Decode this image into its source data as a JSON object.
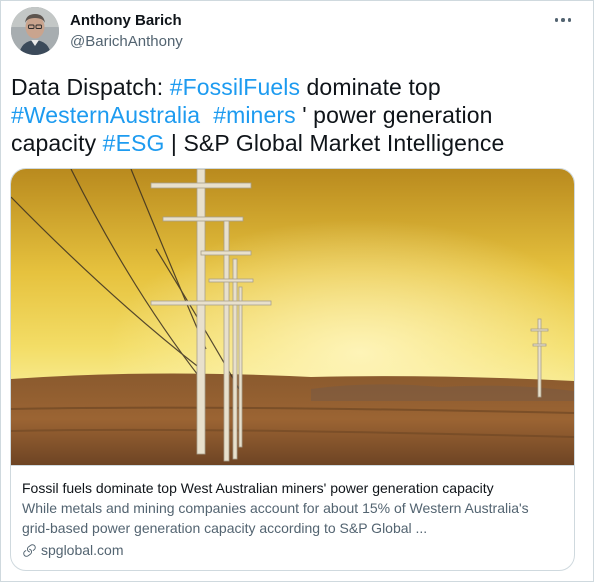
{
  "author": {
    "name": "Anthony Barich",
    "handle": "@BarichAnthony"
  },
  "tweet": {
    "text_1": "Data Dispatch: ",
    "hashtag_1": "#FossilFuels",
    "text_2": " dominate top ",
    "hashtag_2": "#WesternAustralia",
    "text_3": "  ",
    "hashtag_3": "#miners",
    "text_4": " ' power generation capacity ",
    "hashtag_4": "#ESG",
    "text_5": " | S&P Global Market Intelligence"
  },
  "card": {
    "title": "Fossil fuels dominate top West Australian miners' power generation capacity",
    "description": "While metals and mining companies account for about 15% of Western Australia's grid-based power generation capacity according to S&P Global ...",
    "domain": "spglobal.com"
  },
  "colors": {
    "link": "#1d9bf0",
    "secondary_text": "#536471",
    "border": "#cfd9de"
  },
  "icons": {
    "more": "more-icon",
    "link": "link-icon"
  }
}
